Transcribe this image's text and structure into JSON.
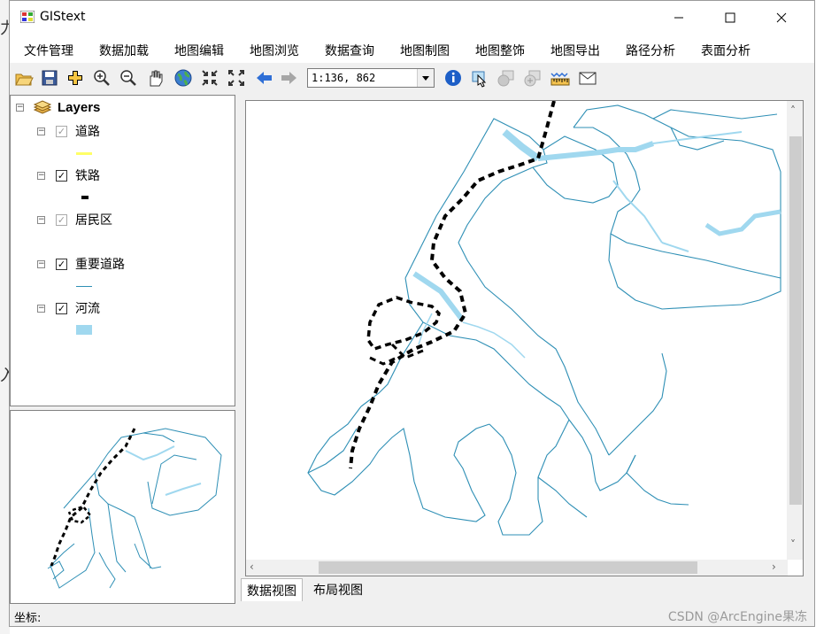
{
  "window": {
    "title": "GIStext"
  },
  "menu": [
    "文件管理",
    "数据加载",
    "地图编辑",
    "地图浏览",
    "数据查询",
    "地图制图",
    "地图整饰",
    "地图导出",
    "路径分析",
    "表面分析"
  ],
  "toolbar": {
    "scale_value": "1:136, 862"
  },
  "toc": {
    "root": "Layers",
    "layers": [
      {
        "name": "道路",
        "checked": true,
        "dim": true,
        "symbol_color": "#ffff66"
      },
      {
        "name": "铁路",
        "checked": true,
        "dim": false,
        "symbol_color": "#000000"
      },
      {
        "name": "居民区",
        "checked": true,
        "dim": true,
        "symbol_color": ""
      },
      {
        "name": "重要道路",
        "checked": true,
        "dim": false,
        "symbol_color": "#2e8fb5"
      },
      {
        "name": "河流",
        "checked": true,
        "dim": false,
        "symbol_color": "#a0d8ef"
      }
    ]
  },
  "tabs": {
    "data_view": "数据视图",
    "layout_view": "布局视图"
  },
  "status": {
    "coord_label": "坐标:"
  },
  "watermark": "CSDN @ArcEngine果冻",
  "colors": {
    "road": "#2e8fb5",
    "river": "#a0d8ef",
    "railway": "#000000"
  }
}
